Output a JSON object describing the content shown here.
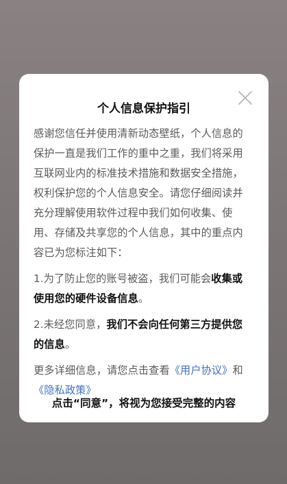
{
  "dialog": {
    "title": "个人信息保护指引",
    "close_icon": "close-icon",
    "intro": "感谢您信任并使用清新动态壁纸，个人信息的保护一直是我们工作的重中之重，我们将采用互联网业内的标准技术措施和数据安全措施，权利保护您的个人信息安全。请您仔细阅读并充分理解使用软件过程中我们如何收集、使用、存储及共享您的个人信息，其中的重点内容已为您标注如下：",
    "point1_prefix": "1.为了防止您的账号被盗，我们可能会",
    "point1_bold": "收集或使用您的硬件设备信息",
    "point1_suffix": "。",
    "point2_prefix": "2.未经您同意，",
    "point2_bold": "我们不会向任何第三方提供您的信息",
    "point2_suffix": "。",
    "more_prefix": "更多详细信息，请您点击查看",
    "user_agreement_link": "《用户协议》",
    "more_and": "和",
    "privacy_policy_link": "《隐私政策》",
    "footer_note": "点击“同意”，将视为您接受完整的内容"
  },
  "colors": {
    "accent_link": "#3f72c2",
    "overlay": "#7c7676",
    "body_text": "#5a5a5a",
    "strong_text": "#111111"
  }
}
